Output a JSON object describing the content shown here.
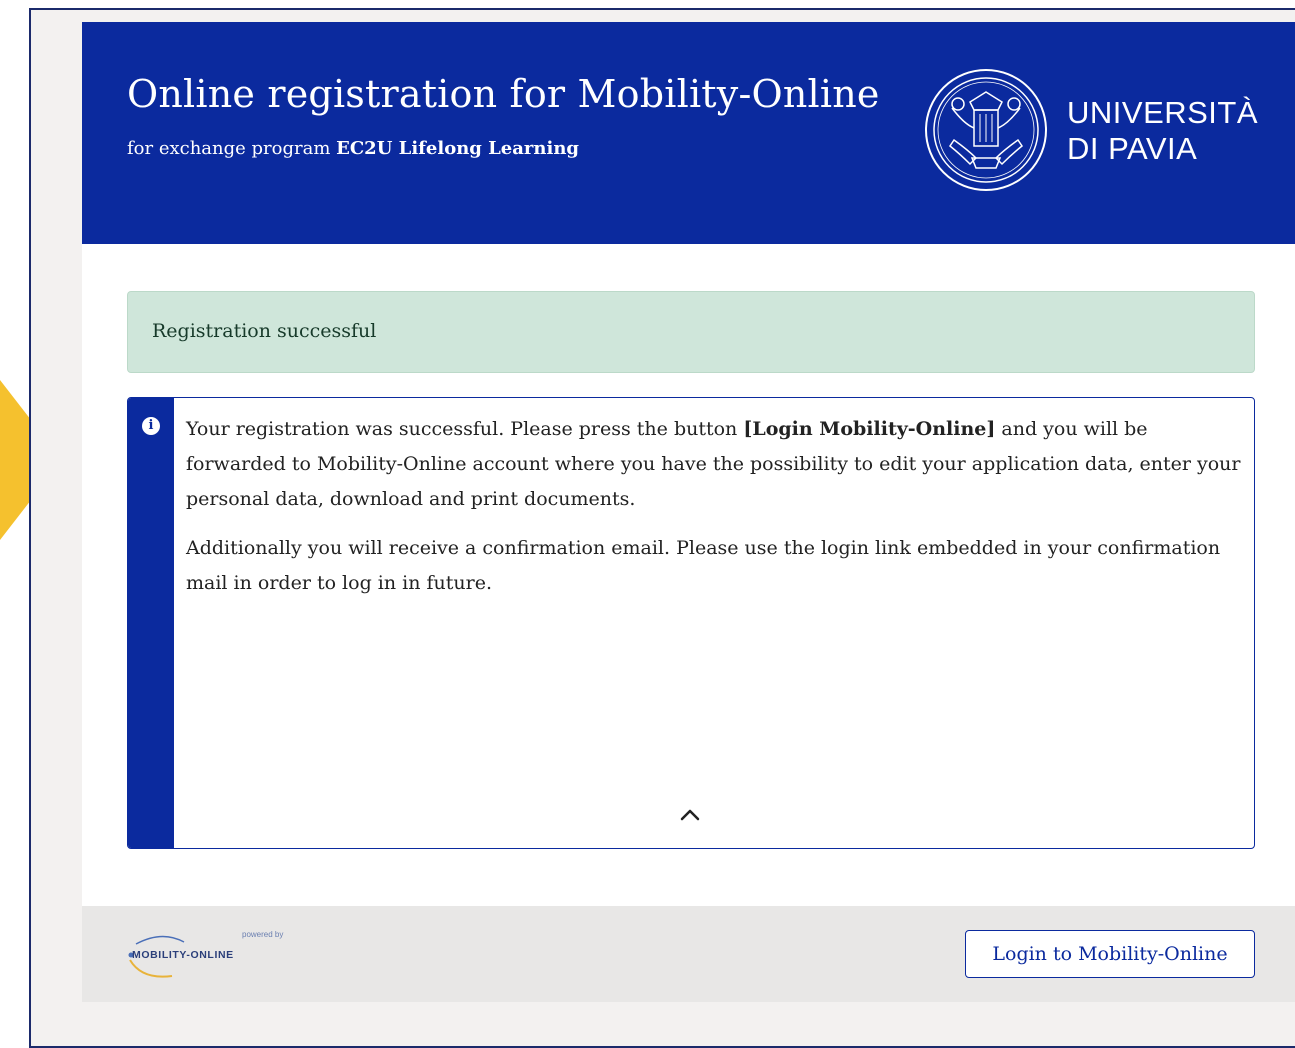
{
  "header": {
    "title": "Online registration for Mobility-Online",
    "subtitle_prefix": "for exchange program ",
    "program_name": "EC2U Lifelong Learning",
    "university_line1": "UNIVERSITÀ",
    "university_line2": "DI PAVIA",
    "seal_icon": "university-seal-icon"
  },
  "status": {
    "success_message": "Registration successful"
  },
  "info": {
    "icon": "info-icon",
    "icon_glyph": "i",
    "para1_before": "Your registration was successful. Please press the button ",
    "para1_button_ref": "[Login Mobility-Online]",
    "para1_after": " and you will be forwarded to Mobility-Online account where you have the possibility to edit your application data, enter your personal data, download and print documents.",
    "para2": "Additionally you will receive a confirmation email. Please use the login link embedded in your confirmation mail in order to log in in future.",
    "collapse_icon": "chevron-up-icon"
  },
  "footer": {
    "powered_by": "powered by",
    "logo_text": "MOBILITY-ONLINE",
    "login_button": "Login to Mobility-Online"
  },
  "colors": {
    "brand_blue": "#0b2a9e",
    "success_bg": "#cfe6da",
    "arrow_accent": "#f5c12e"
  }
}
